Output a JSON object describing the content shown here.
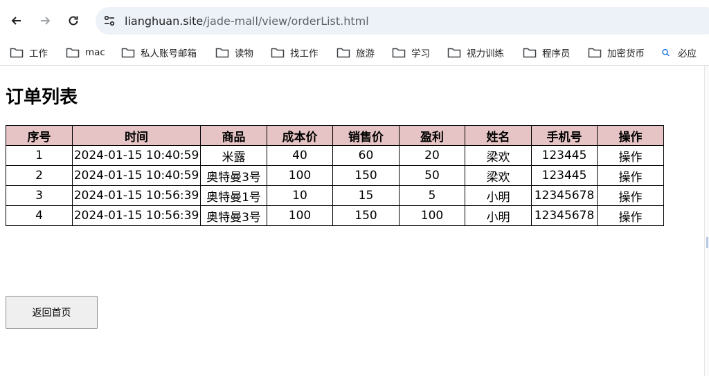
{
  "browser": {
    "url_host": "lianghuan.site",
    "url_path": "/jade-mall/view/orderList.html",
    "bookmarks": [
      {
        "label": "工作",
        "icon": "folder-icon"
      },
      {
        "label": "mac",
        "icon": "folder-icon"
      },
      {
        "label": "私人账号邮箱",
        "icon": "folder-icon"
      },
      {
        "label": "读物",
        "icon": "folder-icon"
      },
      {
        "label": "找工作",
        "icon": "folder-icon"
      },
      {
        "label": "旅游",
        "icon": "folder-icon"
      },
      {
        "label": "学习",
        "icon": "folder-icon"
      },
      {
        "label": "视力训练",
        "icon": "folder-icon"
      },
      {
        "label": "程序员",
        "icon": "folder-icon"
      },
      {
        "label": "加密货币",
        "icon": "folder-icon"
      },
      {
        "label": "必应",
        "icon": "search-icon"
      }
    ]
  },
  "page": {
    "title": "订单列表",
    "back_button": "返回首页"
  },
  "table": {
    "headers": [
      "序号",
      "时间",
      "商品",
      "成本价",
      "销售价",
      "盈利",
      "姓名",
      "手机号",
      "操作"
    ],
    "rows": [
      [
        "1",
        "2024-01-15 10:40:59",
        "米露",
        "40",
        "60",
        "20",
        "梁欢",
        "123445",
        "操作"
      ],
      [
        "2",
        "2024-01-15 10:40:59",
        "奥特曼3号",
        "100",
        "150",
        "50",
        "梁欢",
        "123445",
        "操作"
      ],
      [
        "3",
        "2024-01-15 10:56:39",
        "奥特曼1号",
        "10",
        "15",
        "5",
        "小明",
        "12345678",
        "操作"
      ],
      [
        "4",
        "2024-01-15 10:56:39",
        "奥特曼3号",
        "100",
        "150",
        "100",
        "小明",
        "12345678",
        "操作"
      ]
    ]
  },
  "colors": {
    "header_bg": "#e6c3c4",
    "omnibox_bg": "#edf1f8"
  }
}
